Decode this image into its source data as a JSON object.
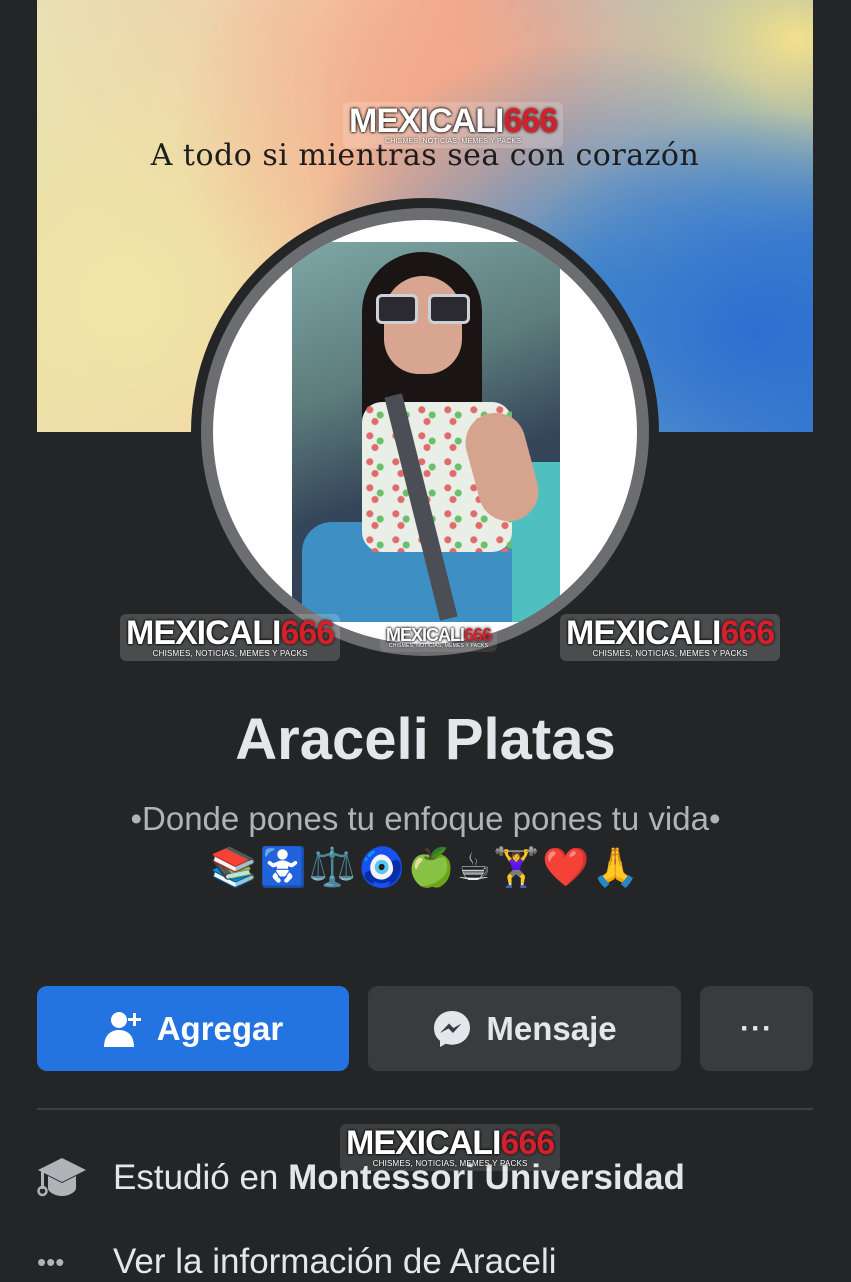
{
  "cover": {
    "quote": "A todo si mientras sea con corazón"
  },
  "watermark": {
    "brand_a": "MEXICALI",
    "brand_b": "666",
    "tagline": "CHISMES, NOTICIAS, MEMES Y PACKS"
  },
  "profile": {
    "name": "Araceli Platas",
    "bio": "•Donde pones tu enfoque pones tu vida•",
    "emojis": "📚🚼⚖️🧿🍏☕🏋️‍♀️❤️🙏"
  },
  "actions": {
    "add_label": "Agregar",
    "message_label": "Mensaje",
    "more_label": "···"
  },
  "info": {
    "study_prefix": "Estudió en ",
    "study_school": "Montessori Universidad",
    "see_info": "Ver la información de Araceli",
    "dots": "•••"
  },
  "icons": [
    "add-friend-icon",
    "messenger-icon",
    "more-icon",
    "graduation-cap-icon",
    "dots-icon"
  ],
  "colors": {
    "background": "#242526",
    "primary_button": "#2374e1",
    "secondary_button": "#3a3b3c",
    "text_primary": "#e4e6eb",
    "text_secondary": "#b0b3b8"
  }
}
